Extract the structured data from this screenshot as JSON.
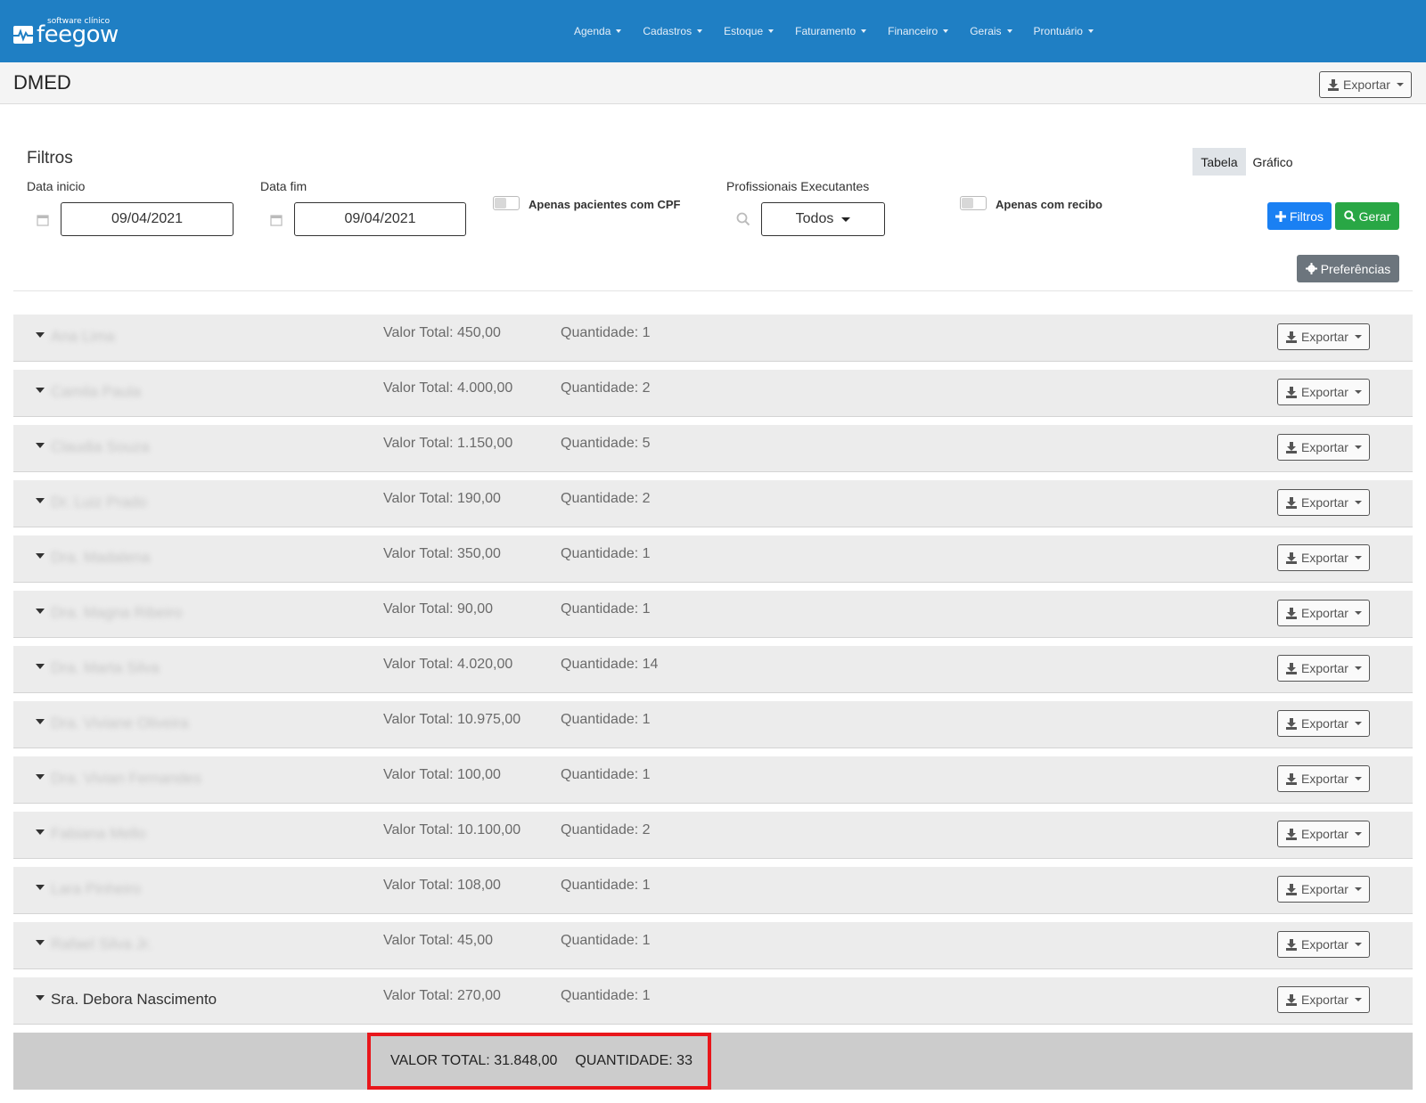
{
  "brand": {
    "name": "feegow",
    "tagline": "software clínico"
  },
  "nav": {
    "items": [
      {
        "label": "Agenda"
      },
      {
        "label": "Cadastros"
      },
      {
        "label": "Estoque"
      },
      {
        "label": "Faturamento"
      },
      {
        "label": "Financeiro"
      },
      {
        "label": "Gerais"
      },
      {
        "label": "Prontuário"
      }
    ]
  },
  "page": {
    "title": "DMED",
    "export_label": "Exportar"
  },
  "filters": {
    "title": "Filtros",
    "data_inicio_label": "Data inicio",
    "data_inicio_value": "09/04/2021",
    "data_fim_label": "Data fim",
    "data_fim_value": "09/04/2021",
    "cpf_toggle_label": "Apenas pacientes com CPF",
    "profissionais_label": "Profissionais Executantes",
    "profissionais_value": "Todos",
    "recibo_toggle_label": "Apenas com recibo",
    "view_tabs": [
      {
        "label": "Tabela",
        "active": true
      },
      {
        "label": "Gráfico",
        "active": false
      }
    ],
    "filtros_button": "Filtros",
    "gerar_button": "Gerar",
    "preferencias_button": "Preferências"
  },
  "rows": [
    {
      "name": "Ana Lima",
      "blurred": true,
      "valor": "Valor Total: 450,00",
      "qtd": "Quantidade: 1",
      "export": "Exportar"
    },
    {
      "name": "Camila Paula",
      "blurred": true,
      "valor": "Valor Total: 4.000,00",
      "qtd": "Quantidade: 2",
      "export": "Exportar"
    },
    {
      "name": "Claudia Souza",
      "blurred": true,
      "valor": "Valor Total: 1.150,00",
      "qtd": "Quantidade: 5",
      "export": "Exportar"
    },
    {
      "name": "Dr. Luiz Prado",
      "blurred": true,
      "valor": "Valor Total: 190,00",
      "qtd": "Quantidade: 2",
      "export": "Exportar"
    },
    {
      "name": "Dra. Madalena",
      "blurred": true,
      "valor": "Valor Total: 350,00",
      "qtd": "Quantidade: 1",
      "export": "Exportar"
    },
    {
      "name": "Dra. Magna Ribeiro",
      "blurred": true,
      "valor": "Valor Total: 90,00",
      "qtd": "Quantidade: 1",
      "export": "Exportar"
    },
    {
      "name": "Dra. Marta Silva",
      "blurred": true,
      "valor": "Valor Total: 4.020,00",
      "qtd": "Quantidade: 14",
      "export": "Exportar"
    },
    {
      "name": "Dra. Viviane Oliveira",
      "blurred": true,
      "valor": "Valor Total: 10.975,00",
      "qtd": "Quantidade: 1",
      "export": "Exportar"
    },
    {
      "name": "Dra. Vivian Fernandes",
      "blurred": true,
      "valor": "Valor Total: 100,00",
      "qtd": "Quantidade: 1",
      "export": "Exportar"
    },
    {
      "name": "Fabiana Mello",
      "blurred": true,
      "valor": "Valor Total: 10.100,00",
      "qtd": "Quantidade: 2",
      "export": "Exportar"
    },
    {
      "name": "Lara Pinheiro",
      "blurred": true,
      "valor": "Valor Total: 108,00",
      "qtd": "Quantidade: 1",
      "export": "Exportar"
    },
    {
      "name": "Rafael Silva Jr.",
      "blurred": true,
      "valor": "Valor Total: 45,00",
      "qtd": "Quantidade: 1",
      "export": "Exportar"
    },
    {
      "name": "Sra. Debora Nascimento",
      "blurred": false,
      "valor": "Valor Total: 270,00",
      "qtd": "Quantidade: 1",
      "export": "Exportar"
    }
  ],
  "totals": {
    "valor": "VALOR TOTAL: 31.848,00",
    "qtd": "QUANTIDADE: 33"
  },
  "colors": {
    "navbar": "#1f7fc4",
    "primary": "#1a80f3",
    "success": "#29a745",
    "secondary": "#6c757d",
    "highlight": "#e8161b"
  }
}
